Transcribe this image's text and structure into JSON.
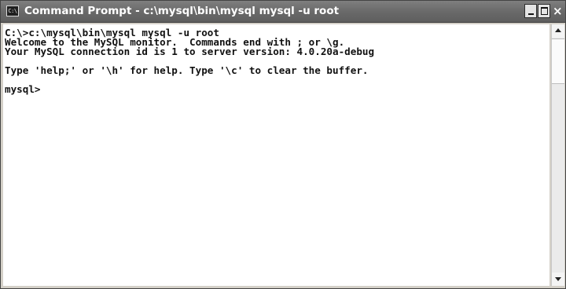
{
  "window": {
    "title": "Command Prompt - c:\\mysql\\bin\\mysql mysql -u root",
    "icon": "cmd-icon",
    "icon_text": "C:\\",
    "controls": {
      "minimize": "minimize-icon",
      "maximize": "maximize-icon",
      "close": "close-icon",
      "close_glyph": "×"
    }
  },
  "console": {
    "lines": [
      "C:\\>c:\\mysql\\bin\\mysql mysql -u root",
      "Welcome to the MySQL monitor.  Commands end with ; or \\g.",
      "Your MySQL connection id is 1 to server version: 4.0.20a-debug",
      "",
      "Type 'help;' or '\\h' for help. Type '\\c' to clear the buffer.",
      "",
      "mysql>"
    ]
  },
  "colors": {
    "titlebar": "#6a6a6a",
    "title_text": "#ffffff",
    "console_bg": "#ffffff",
    "console_text": "#111111"
  }
}
